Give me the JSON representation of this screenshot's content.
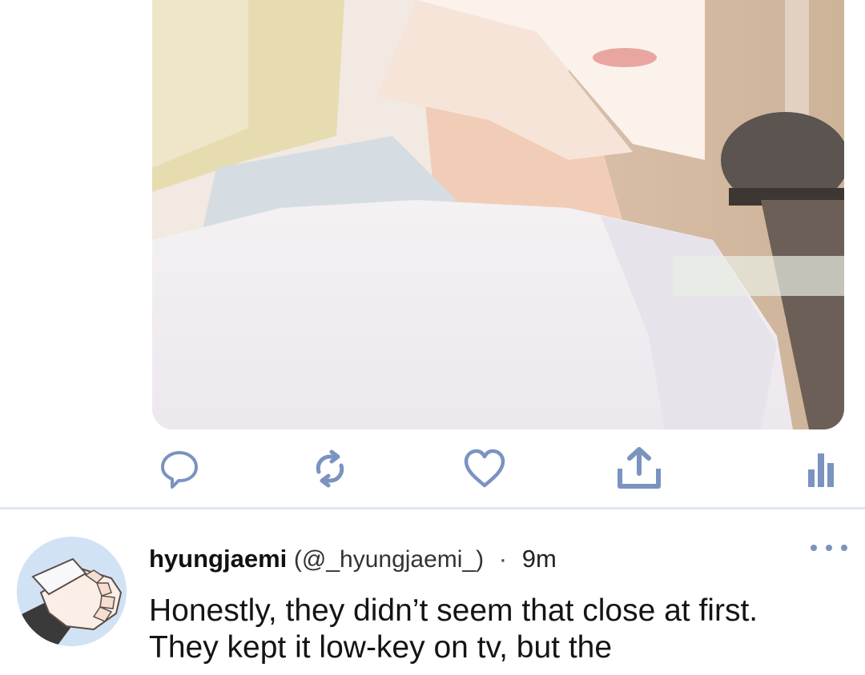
{
  "colors": {
    "accent": "#7a93c0",
    "divider": "#dfe6f2",
    "text": "#141414"
  },
  "media": {
    "kind": "illustration",
    "icon": "anime-illustration-image"
  },
  "action_bar": {
    "reply_icon": "reply-icon",
    "retweet_icon": "retweet-icon",
    "like_icon": "heart-icon",
    "share_icon": "share-icon",
    "analytics_icon": "analytics-icon"
  },
  "tweet": {
    "display_name": "hyungjaemi",
    "handle": "(@_hyungjaemi_)",
    "separator": "·",
    "time": "9m",
    "text_lines": [
      "Honestly, they didn’t seem that close at first.",
      "They kept it low-key on tv, but the"
    ],
    "more_icon": "more-options-icon"
  }
}
